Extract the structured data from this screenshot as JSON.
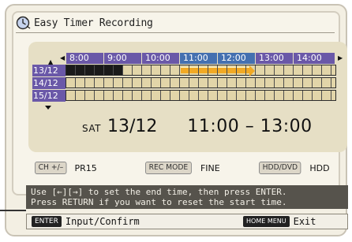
{
  "screen": {
    "title": "Easy Timer Recording",
    "title_icon": "clock-icon"
  },
  "timeline": {
    "hours": [
      "8:00",
      "9:00",
      "10:00",
      "11:00",
      "12:00",
      "13:00",
      "14:00"
    ],
    "selected_hours": [
      "11:00",
      "12:00"
    ],
    "dates": [
      "13/12",
      "14/12",
      "15/12"
    ],
    "colors": {
      "header_purple": "#6a58a8",
      "header_blue": "#4470b0",
      "timeline_fill": "#e2d5a9",
      "selection": "#f1a925",
      "recorded_block": "#1a1a1a"
    }
  },
  "selection": {
    "day_of_week": "SAT",
    "date": "13/12",
    "time_range": "11:00 – 13:00"
  },
  "controls": {
    "channel_key": "CH +/–",
    "channel_value": "PR15",
    "rec_mode_key": "REC MODE",
    "rec_mode_value": "FINE",
    "media_key": "HDD/DVD",
    "media_value": "HDD"
  },
  "message": {
    "line1": "Use [←][→] to set the end time, then press ENTER.",
    "line2": "Press RETURN if you want to reset the start time."
  },
  "footer": {
    "enter_key": "ENTER",
    "enter_label": "Input/Confirm",
    "home_key": "HOME MENU",
    "home_label": "Exit"
  }
}
